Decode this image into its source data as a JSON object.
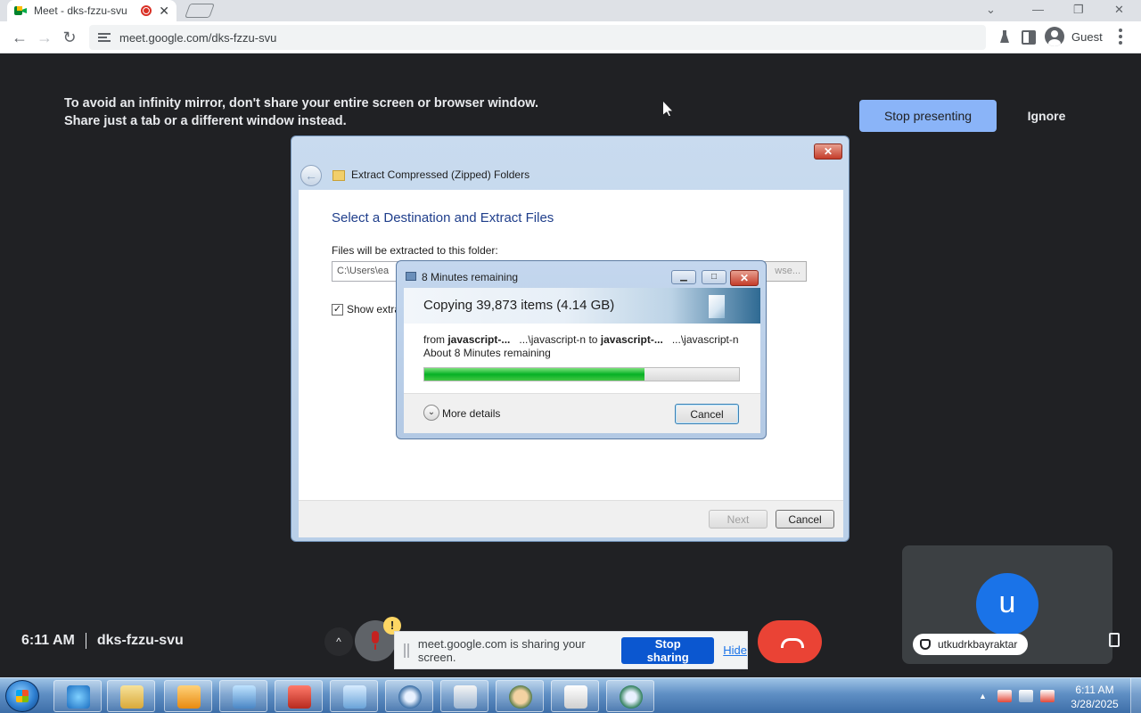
{
  "browser": {
    "tab_title": "Meet - dks-fzzu-svu",
    "tab_close": "✕",
    "url": "meet.google.com/dks-fzzu-svu",
    "profile_label": "Guest",
    "window_controls": {
      "dropdown": "⌄",
      "minimize": "—",
      "restore": "❐",
      "close": "✕"
    },
    "nav": {
      "back": "←",
      "forward": "→",
      "reload": "↻"
    }
  },
  "meet": {
    "warning": "To avoid an infinity mirror, don't share your entire screen or browser window. Share just a tab or a different window instead.",
    "stop_presenting_label": "Stop presenting",
    "ignore_label": "Ignore",
    "time": "6:11 AM",
    "meeting_code": "dks-fzzu-svu",
    "participant": {
      "initial": "u",
      "name": "utkudrkbayraktar"
    },
    "warning_badge": "!",
    "expand_arrow": "^",
    "share_bar": {
      "text": "meet.google.com is sharing your screen.",
      "stop_label": "Stop sharing",
      "hide_label": "Hide"
    }
  },
  "extract_dialog": {
    "title": "Extract Compressed (Zipped) Folders",
    "close_label": "✕",
    "back_arrow": "←",
    "heading": "Select a Destination and Extract Files",
    "folder_label": "Files will be extracted to this folder:",
    "path_value": "C:\\Users\\ea",
    "browse_label": "wse...",
    "checkbox_mark": "✓",
    "checkbox_label": "Show extra",
    "next_label": "Next",
    "cancel_label": "Cancel"
  },
  "copy_dialog": {
    "title": "8 Minutes remaining",
    "minimize": "▁",
    "restore": "□",
    "close": "✕",
    "heading": "Copying 39,873 items (4.14 GB)",
    "from_prefix": "from",
    "from_source": "javascript-...",
    "from_source_path": "...\\javascript-n",
    "to_word": "to",
    "to_dest": "javascript-...",
    "to_dest_path": "...\\javascript-n",
    "remaining": "About 8 Minutes remaining",
    "progress_percent": 70,
    "details_chevron": "⌄",
    "more_details_label": "More details",
    "cancel_label": "Cancel"
  },
  "taskbar": {
    "time": "6:11 AM",
    "date": "3/28/2025",
    "tray_arrow": "▲"
  }
}
